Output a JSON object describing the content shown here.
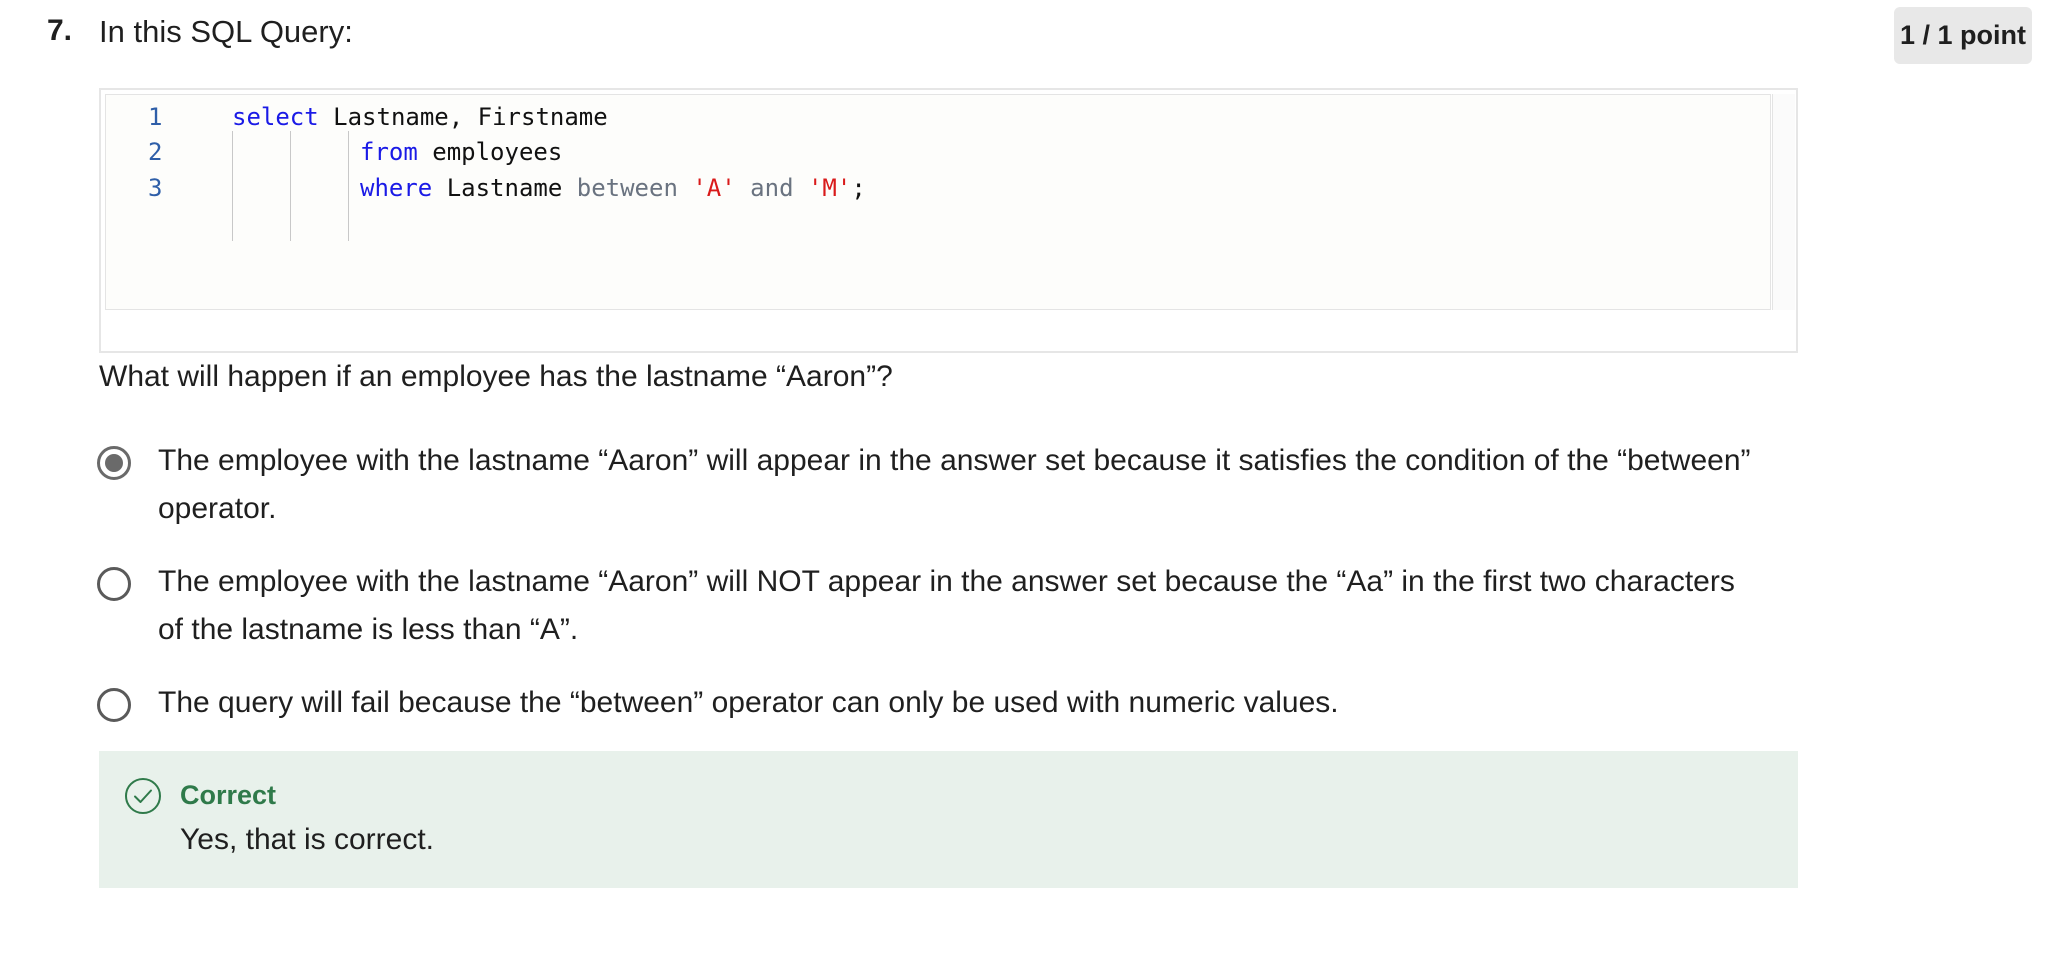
{
  "question": {
    "number": "7.",
    "title": "In this SQL Query:",
    "points": "1 / 1 point",
    "prompt": "What will happen if an employee has the lastname “Aaron”?"
  },
  "code": {
    "lines": [
      {
        "num": "1",
        "kw1": "select",
        "t1": " Lastname, Firstname"
      },
      {
        "num": "2",
        "kw1": "from",
        "t1": " employees"
      },
      {
        "num": "3",
        "kw1": "where",
        "t1": " Lastname ",
        "op1": "between",
        "s1": "'A'",
        "op2": "and",
        "s2": "'M'",
        "end": ";"
      }
    ]
  },
  "options": [
    {
      "text": "The employee with the lastname “Aaron” will appear in the answer set because it satisfies the condition of the “between” operator.",
      "selected": true
    },
    {
      "text": "The employee with the lastname “Aaron” will NOT appear in the answer set because the “Aa” in the first two characters of the lastname is less than “A”.",
      "selected": false
    },
    {
      "text": "The query will fail because the “between” operator can only be used with numeric values.",
      "selected": false
    }
  ],
  "feedback": {
    "status": "Correct",
    "message": "Yes, that is correct."
  },
  "colors": {
    "keyword": "#1a1ae6",
    "operator": "#6a7380",
    "string": "#d91a1a",
    "line_number": "#2e5ea8",
    "feedback_bg": "#e8f1eb",
    "feedback_title": "#2f7a4a"
  }
}
